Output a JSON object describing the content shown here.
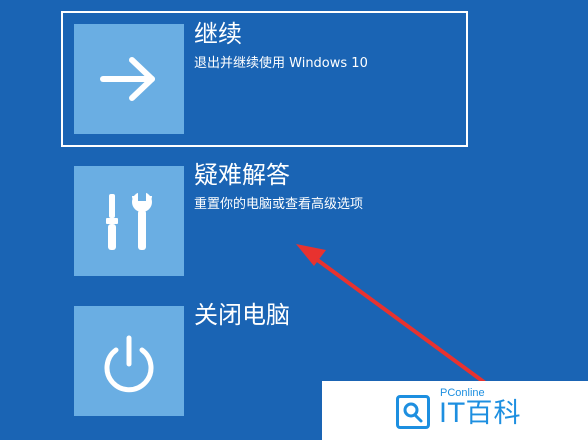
{
  "options": [
    {
      "id": "continue",
      "icon": "arrow-right-icon",
      "title": "继续",
      "subtitle": "退出并继续使用 Windows 10",
      "selected": true
    },
    {
      "id": "troubleshoot",
      "icon": "tools-icon",
      "title": "疑难解答",
      "subtitle": "重置你的电脑或查看高级选项",
      "selected": false
    },
    {
      "id": "shutdown",
      "icon": "power-icon",
      "title": "关闭电脑",
      "selected": false
    }
  ],
  "annotation": {
    "type": "red-arrow",
    "points_to": "troubleshoot"
  },
  "watermark": {
    "small": "PConline",
    "big": "IT百科",
    "icon": "search-logo-icon"
  },
  "colors": {
    "background": "#1a64b4",
    "tile": "#6aaee3",
    "text": "#ffffff",
    "annotation": "#e8322f",
    "watermark_blue": "#1d8fe0"
  }
}
